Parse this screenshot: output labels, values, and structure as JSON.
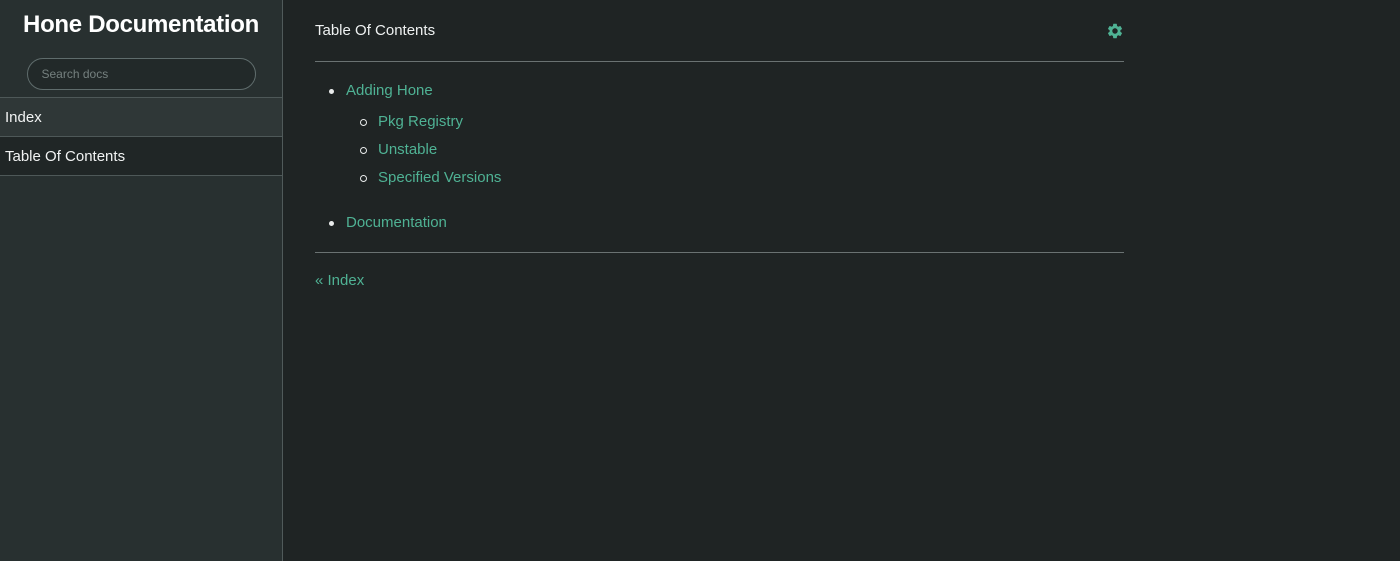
{
  "sidebar": {
    "title": "Hone Documentation",
    "search_placeholder": "Search docs",
    "items": [
      {
        "label": "Index"
      },
      {
        "label": "Table Of Contents"
      }
    ]
  },
  "header": {
    "title": "Table Of Contents",
    "settings_icon": "gear-icon"
  },
  "toc": {
    "items": [
      {
        "label": "Adding Hone",
        "children": [
          {
            "label": "Pkg Registry"
          },
          {
            "label": "Unstable"
          },
          {
            "label": "Specified Versions"
          }
        ]
      },
      {
        "label": "Documentation"
      }
    ]
  },
  "footer_nav": {
    "prev_label": "« Index"
  },
  "colors": {
    "accent": "#4fb294",
    "sidebar_bg": "#283030",
    "main_bg": "#1f2424"
  }
}
